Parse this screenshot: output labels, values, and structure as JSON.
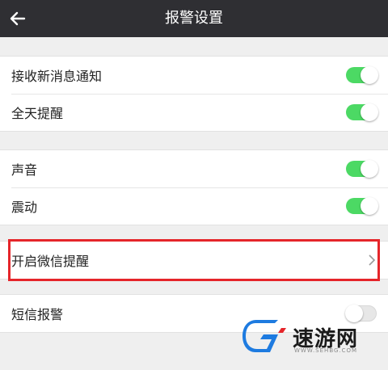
{
  "header": {
    "title": "报警设置",
    "back_icon": "arrow-left-icon"
  },
  "groups": [
    {
      "items": [
        {
          "label": "接收新消息通知",
          "control": "toggle",
          "on": true
        },
        {
          "label": "全天提醒",
          "control": "toggle",
          "on": true
        }
      ]
    },
    {
      "items": [
        {
          "label": "声音",
          "control": "toggle",
          "on": true
        },
        {
          "label": "震动",
          "control": "toggle",
          "on": true
        }
      ]
    },
    {
      "items": [
        {
          "label": "开启微信提醒",
          "control": "chevron",
          "icon": "chevron-right-icon"
        }
      ]
    },
    {
      "items": [
        {
          "label": "短信报警",
          "control": "toggle",
          "on": false
        }
      ]
    }
  ],
  "watermark": {
    "text": "速游网",
    "url_text": "WWW.SEHBG.COM"
  },
  "colors": {
    "header_bg": "#2f2f33",
    "toggle_on": "#4cd964",
    "highlight": "#e5252a",
    "logo_blue": "#1e7be0"
  }
}
